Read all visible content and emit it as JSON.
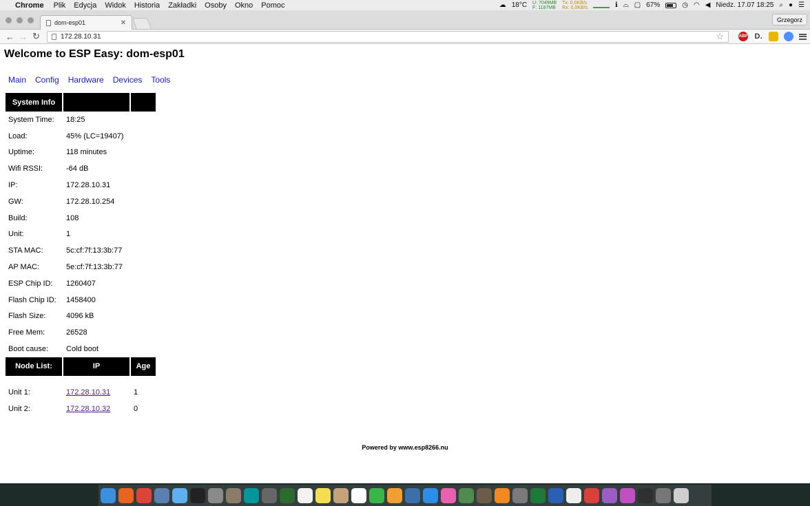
{
  "menubar": {
    "app": "Chrome",
    "items": [
      "Plik",
      "Edycja",
      "Widok",
      "Historia",
      "Zakładki",
      "Osoby",
      "Okno",
      "Pomoc"
    ],
    "temperature": "18°C",
    "stats_u": "U: 7049MB",
    "stats_f": "F: 1187MB",
    "stats_tx": "Tx: 0,0KB/s",
    "stats_rx": "Rx: 0,0KB/s",
    "battery": "67%",
    "datetime": "Niedz. 17.07  18:25"
  },
  "browser": {
    "tab_title": "dom-esp01",
    "profile": "Grzegorz",
    "url": "172.28.10.31",
    "ext_abp": "ABP",
    "ext_d": "D."
  },
  "page": {
    "title": "Welcome to ESP Easy: dom-esp01",
    "nav": [
      "Main",
      "Config",
      "Hardware",
      "Devices",
      "Tools"
    ],
    "system_header": "System Info",
    "system_rows": [
      {
        "label": "System Time:",
        "value": "18:25"
      },
      {
        "label": "Load:",
        "value": "45% (LC=19407)"
      },
      {
        "label": "Uptime:",
        "value": "118 minutes"
      },
      {
        "label": "Wifi RSSI:",
        "value": "-64 dB"
      },
      {
        "label": "IP:",
        "value": "172.28.10.31"
      },
      {
        "label": "GW:",
        "value": "172.28.10.254"
      },
      {
        "label": "Build:",
        "value": "108"
      },
      {
        "label": "Unit:",
        "value": "1"
      },
      {
        "label": "STA MAC:",
        "value": "5c:cf:7f:13:3b:77"
      },
      {
        "label": "AP MAC:",
        "value": "5e:cf:7f:13:3b:77"
      },
      {
        "label": "ESP Chip ID:",
        "value": "1260407"
      },
      {
        "label": "Flash Chip ID:",
        "value": "1458400"
      },
      {
        "label": "Flash Size:",
        "value": "4096 kB"
      },
      {
        "label": "Free Mem:",
        "value": "26528"
      },
      {
        "label": "Boot cause:",
        "value": "Cold boot"
      }
    ],
    "node_headers": [
      "Node List:",
      "IP",
      "Age"
    ],
    "nodes": [
      {
        "unit": "Unit 1:",
        "ip": "172.28.10.31",
        "age": "1"
      },
      {
        "unit": "Unit 2:",
        "ip": "172.28.10.32",
        "age": "0"
      }
    ],
    "footer": "Powered by www.esp8266.nu"
  },
  "dock": {
    "icons": [
      {
        "name": "finder-icon",
        "color": "#3c8ee0"
      },
      {
        "name": "firefox-icon",
        "color": "#e8651f"
      },
      {
        "name": "chrome-icon",
        "color": "#db4437"
      },
      {
        "name": "preview-icon",
        "color": "#5a7fb0"
      },
      {
        "name": "messages-icon",
        "color": "#5fb0f0"
      },
      {
        "name": "terminal-icon",
        "color": "#222222"
      },
      {
        "name": "launchpad-icon",
        "color": "#8a8a8a"
      },
      {
        "name": "notes-folder-icon",
        "color": "#8a7c68"
      },
      {
        "name": "arduino-icon",
        "color": "#00979c"
      },
      {
        "name": "tools-icon",
        "color": "#666666"
      },
      {
        "name": "activity-icon",
        "color": "#2d6a2d"
      },
      {
        "name": "textedit-icon",
        "color": "#f2f2f2"
      },
      {
        "name": "stickies-icon",
        "color": "#f5dd52"
      },
      {
        "name": "contacts-icon",
        "color": "#c4a27a"
      },
      {
        "name": "calendar-icon",
        "color": "#ffffff"
      },
      {
        "name": "facetime-icon",
        "color": "#3ab54a"
      },
      {
        "name": "photos-icon",
        "color": "#f0a030"
      },
      {
        "name": "virtualbox-icon",
        "color": "#3c6ea8"
      },
      {
        "name": "app-store-icon",
        "color": "#2d8ee8"
      },
      {
        "name": "itunes-icon",
        "color": "#e860b0"
      },
      {
        "name": "gps-icon",
        "color": "#4f8a4f"
      },
      {
        "name": "gimp-icon",
        "color": "#6b5b4a"
      },
      {
        "name": "ibooks-icon",
        "color": "#f08a20"
      },
      {
        "name": "preferences-icon",
        "color": "#7a7a7a"
      },
      {
        "name": "excel-icon",
        "color": "#1f7a3a"
      },
      {
        "name": "word-icon",
        "color": "#2b5fb5"
      },
      {
        "name": "document-icon",
        "color": "#eeeeee"
      },
      {
        "name": "mail-icon",
        "color": "#d8413a"
      },
      {
        "name": "image-capture-icon",
        "color": "#9b5cc4"
      },
      {
        "name": "fcp-icon",
        "color": "#c050c0"
      },
      {
        "name": "activity-monitor-icon",
        "color": "#303030"
      },
      {
        "name": "downloads-icon",
        "color": "#777777"
      },
      {
        "name": "trash-icon",
        "color": "#cfcfcf"
      }
    ]
  }
}
